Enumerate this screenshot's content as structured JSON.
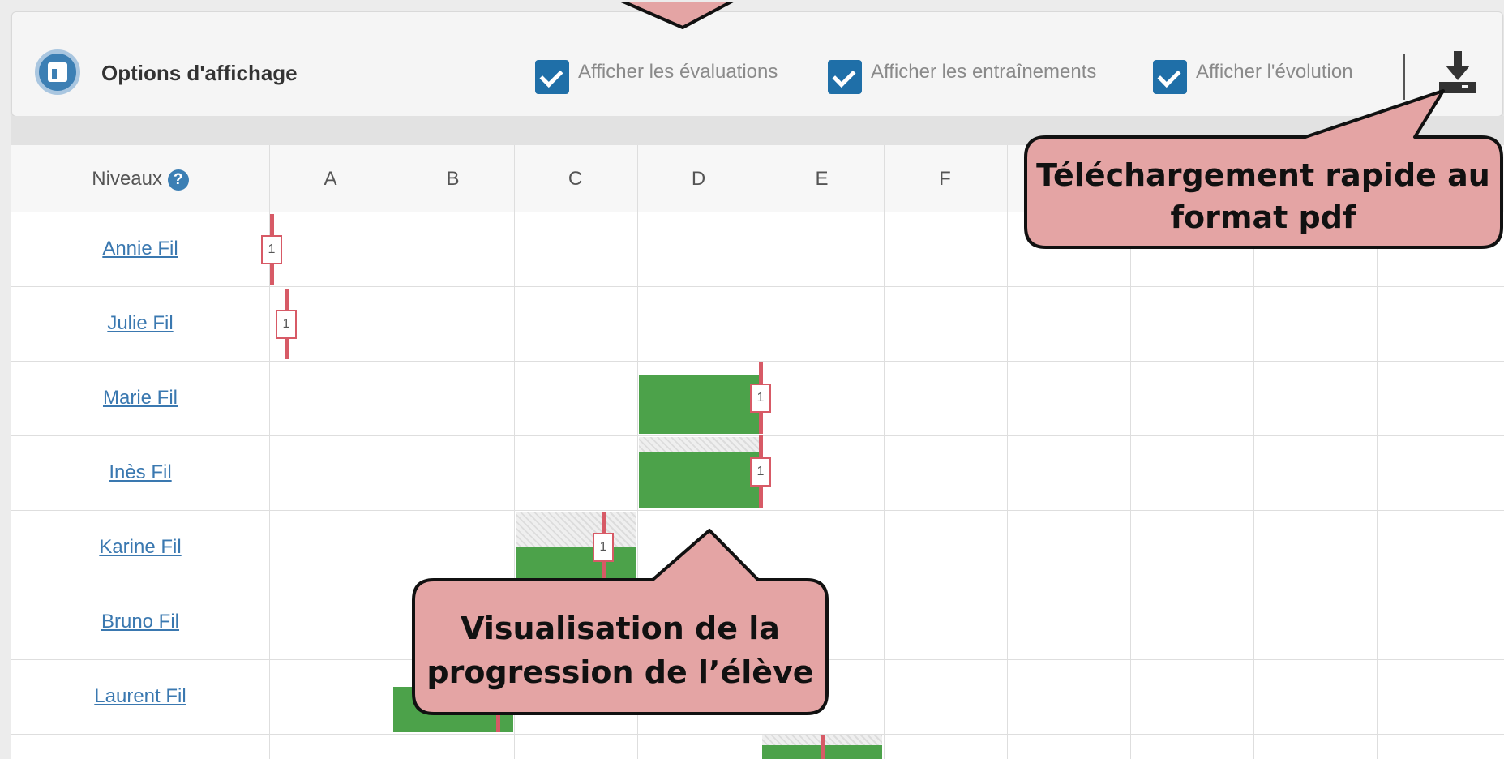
{
  "options": {
    "title": "Options d'affichage",
    "checkboxes": [
      {
        "label": "Afficher les évaluations",
        "checked": true
      },
      {
        "label": "Afficher les entraînements",
        "checked": true
      },
      {
        "label": "Afficher l'évolution",
        "checked": true
      }
    ],
    "download_icon": "download-icon"
  },
  "grid": {
    "header_label": "Niveaux",
    "help_icon": "?",
    "columns": [
      "A",
      "B",
      "C",
      "D",
      "E",
      "F"
    ],
    "students": [
      {
        "name": "Annie Fil",
        "level": "A",
        "count": "1"
      },
      {
        "name": "Julie Fil",
        "level": "A",
        "count": "1"
      },
      {
        "name": "Marie Fil",
        "progress_from": "D",
        "level": "D",
        "count": "1"
      },
      {
        "name": "Inès Fil",
        "progress_from": "D",
        "level": "D",
        "count": "1"
      },
      {
        "name": "Karine Fil",
        "progress_from": "C",
        "level": "C",
        "count": "1"
      },
      {
        "name": "Bruno Fil"
      },
      {
        "name": "Laurent Fil",
        "progress_from": "B",
        "level": "B"
      }
    ]
  },
  "callouts": {
    "download": [
      "Téléchargement rapide au",
      "format pdf"
    ],
    "progress": [
      "Visualisation de la",
      "progression de l’élève"
    ]
  },
  "colors": {
    "accent": "#1f6fa8",
    "progress_bar": "#4ca24a",
    "marker": "#d75a66",
    "callout_fill": "#e4a4a4",
    "link": "#3a78b0"
  }
}
